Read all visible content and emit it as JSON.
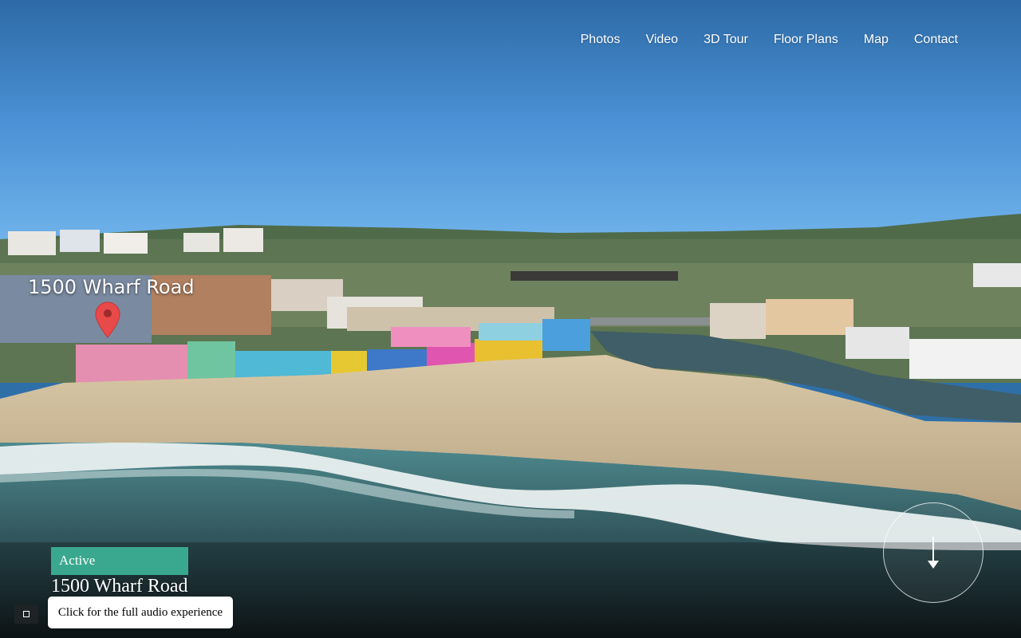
{
  "nav": {
    "items": [
      "Photos",
      "Video",
      "3D Tour",
      "Floor Plans",
      "Map",
      "Contact"
    ]
  },
  "hero": {
    "map_label": "1500 Wharf Road",
    "status": "Active",
    "address": "1500 Wharf Road",
    "audio_label": "Click for the full audio experience"
  },
  "colors": {
    "accent": "#3aa88e",
    "pin": "#e84a4a",
    "sky": "#4a90d4"
  },
  "icons": [
    "map-pin-icon",
    "arrow-down-icon",
    "audio-toggle-icon"
  ]
}
